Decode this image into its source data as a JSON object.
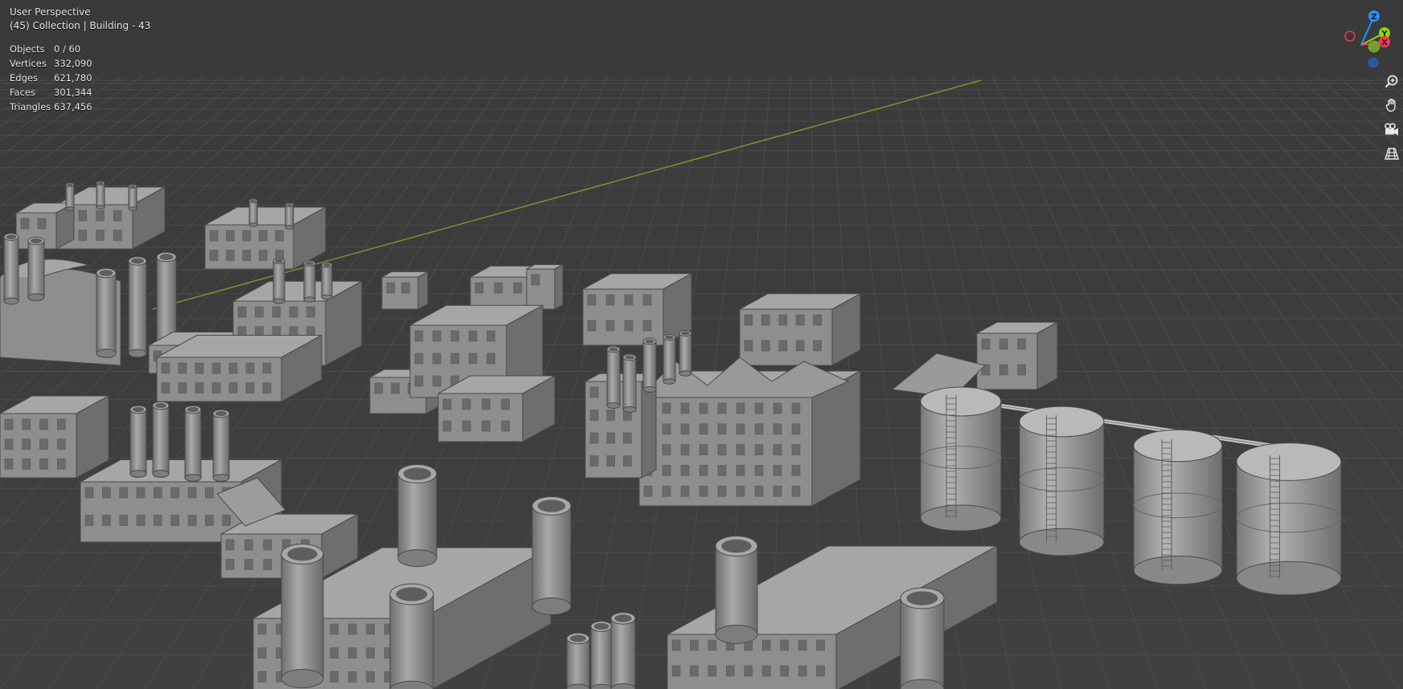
{
  "viewport": {
    "view_name": "User Perspective",
    "collection_info": "(45) Collection | Building - 43"
  },
  "stats": [
    {
      "label": "Objects",
      "value": "0 / 60"
    },
    {
      "label": "Vertices",
      "value": "332,090"
    },
    {
      "label": "Edges",
      "value": "621,780"
    },
    {
      "label": "Faces",
      "value": "301,344"
    },
    {
      "label": "Triangles",
      "value": "637,456"
    }
  ],
  "gizmo": {
    "z_label": "Z",
    "y_label": "Y",
    "x_label": "X",
    "colors": {
      "x": "#ff3352",
      "y": "#8bdc00",
      "z": "#2890ff"
    }
  },
  "tools": [
    {
      "name": "zoom",
      "icon": "magnifier-plus-icon"
    },
    {
      "name": "pan",
      "icon": "hand-icon"
    },
    {
      "name": "camera",
      "icon": "camera-icon"
    },
    {
      "name": "ortho",
      "icon": "grid-icon"
    }
  ],
  "colors": {
    "background": "#3d3d3d",
    "grid_line": "#4a4a4a",
    "y_axis_line": "#6f9a2a",
    "model_fill": "#8e8e8e"
  }
}
